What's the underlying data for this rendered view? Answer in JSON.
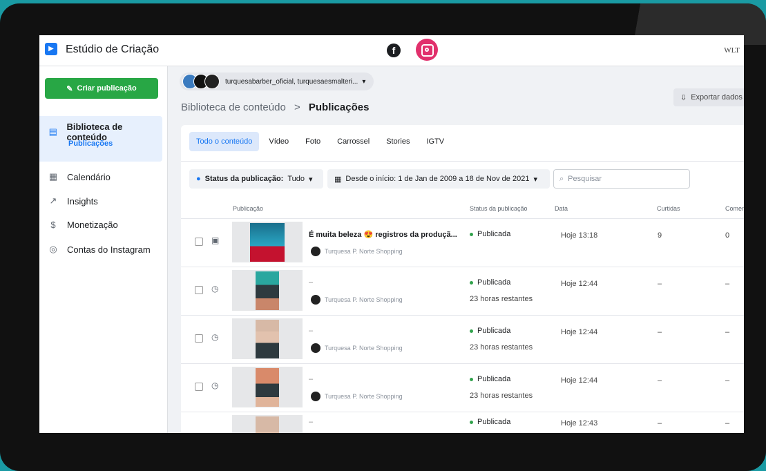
{
  "header": {
    "app_title": "Estúdio de Criação",
    "brand_mark": "WLT"
  },
  "sidebar": {
    "create_label": "Criar publicação",
    "items": [
      {
        "label": "Biblioteca de conteúdo",
        "icon": "library-icon"
      },
      {
        "label": "Calendário",
        "icon": "calendar-icon"
      },
      {
        "label": "Insights",
        "icon": "insights-icon"
      },
      {
        "label": "Monetização",
        "icon": "dollar-icon"
      },
      {
        "label": "Contas do Instagram",
        "icon": "accounts-icon"
      }
    ],
    "sub_active": "Publicações"
  },
  "main": {
    "account_selector": "turquesabarber_oficial, turquesaesmalteri...",
    "breadcrumb": {
      "parent": "Biblioteca de conteúdo",
      "sep": ">",
      "current": "Publicações"
    },
    "export_label": "Exportar dados",
    "tabs": [
      "Todo o conteúdo",
      "Vídeo",
      "Foto",
      "Carrossel",
      "Stories",
      "IGTV"
    ],
    "filters": {
      "status_label": "Status da publicação:",
      "status_value": "Tudo",
      "date_range": "Desde o início: 1 de Jan de 2009 a 18 de Nov de 2021",
      "search_placeholder": "Pesquisar"
    },
    "columns": [
      "Publicação",
      "Status da publicação",
      "Data",
      "Curtidas",
      "Comen"
    ],
    "rows": [
      {
        "title": "É muita beleza 😍 registros da produçã...",
        "page": "Turquesa P. Norte Shopping",
        "status": "Publicada",
        "remaining": "",
        "date": "Hoje 13:18",
        "likes": "9",
        "comments": "0"
      },
      {
        "title": "–",
        "page": "Turquesa P. Norte Shopping",
        "status": "Publicada",
        "remaining": "23 horas restantes",
        "date": "Hoje 12:44",
        "likes": "–",
        "comments": "–"
      },
      {
        "title": "–",
        "page": "Turquesa P. Norte Shopping",
        "status": "Publicada",
        "remaining": "23 horas restantes",
        "date": "Hoje 12:44",
        "likes": "–",
        "comments": "–"
      },
      {
        "title": "–",
        "page": "Turquesa P. Norte Shopping",
        "status": "Publicada",
        "remaining": "23 horas restantes",
        "date": "Hoje 12:44",
        "likes": "–",
        "comments": "–"
      },
      {
        "title": "–",
        "page": "",
        "status": "Publicada",
        "remaining": "",
        "date": "Hoje 12:43",
        "likes": "–",
        "comments": "–"
      }
    ]
  }
}
